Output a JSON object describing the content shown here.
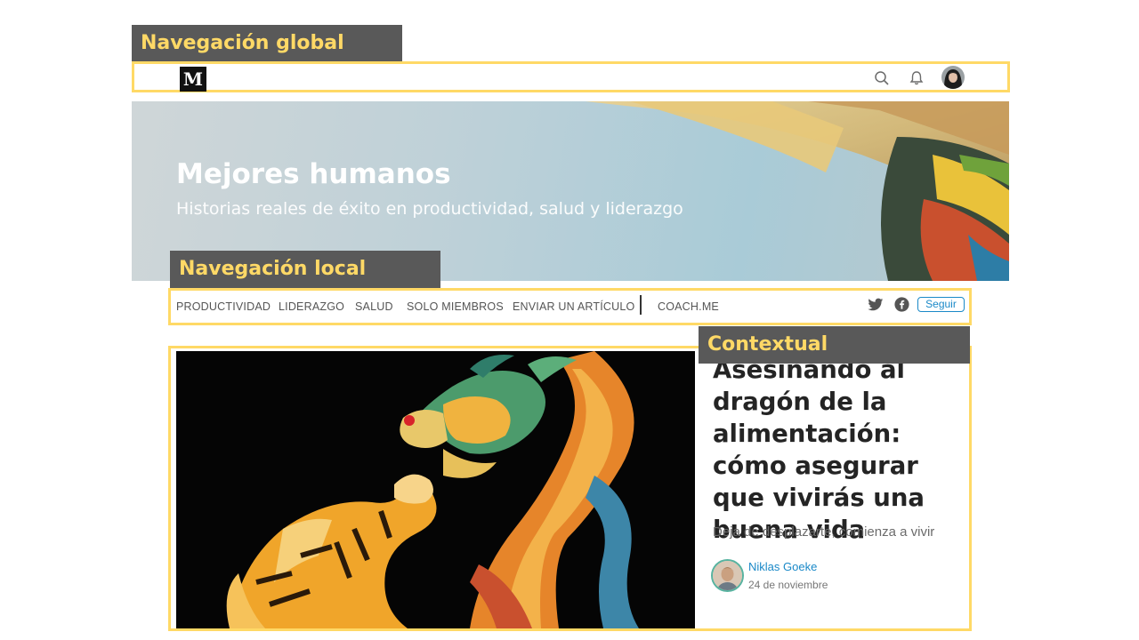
{
  "annotations": {
    "global_nav": "Navegación global",
    "local_nav": "Navegación local",
    "contextual": "Contextual"
  },
  "global_nav": {
    "logo": "M",
    "icons": [
      "search-icon",
      "bell-icon",
      "user-avatar"
    ]
  },
  "hero": {
    "title": "Mejores humanos",
    "subtitle": "Historias reales de éxito en productividad, salud y liderazgo"
  },
  "local_nav": {
    "items": [
      "PRODUCTIVIDAD",
      "LIDERAZGO",
      "SALUD",
      "SOLO MIEMBROS",
      "ENVIAR UN ARTÍCULO"
    ],
    "external": "COACH.ME",
    "follow_label": "Seguir",
    "icons": [
      "twitter-icon",
      "facebook-icon"
    ]
  },
  "featured_article": {
    "title": "Asesinando al dragón de la alimentación: cómo asegurar que vivirás una buena vida",
    "subtitle": "Deja de desplazarte, comienza a vivir",
    "author": "Niklas Goeke",
    "date": "24 de noviembre"
  },
  "colors": {
    "annotation_border": "#ffd966",
    "annotation_bg": "#595959",
    "link": "#1a89c8"
  }
}
